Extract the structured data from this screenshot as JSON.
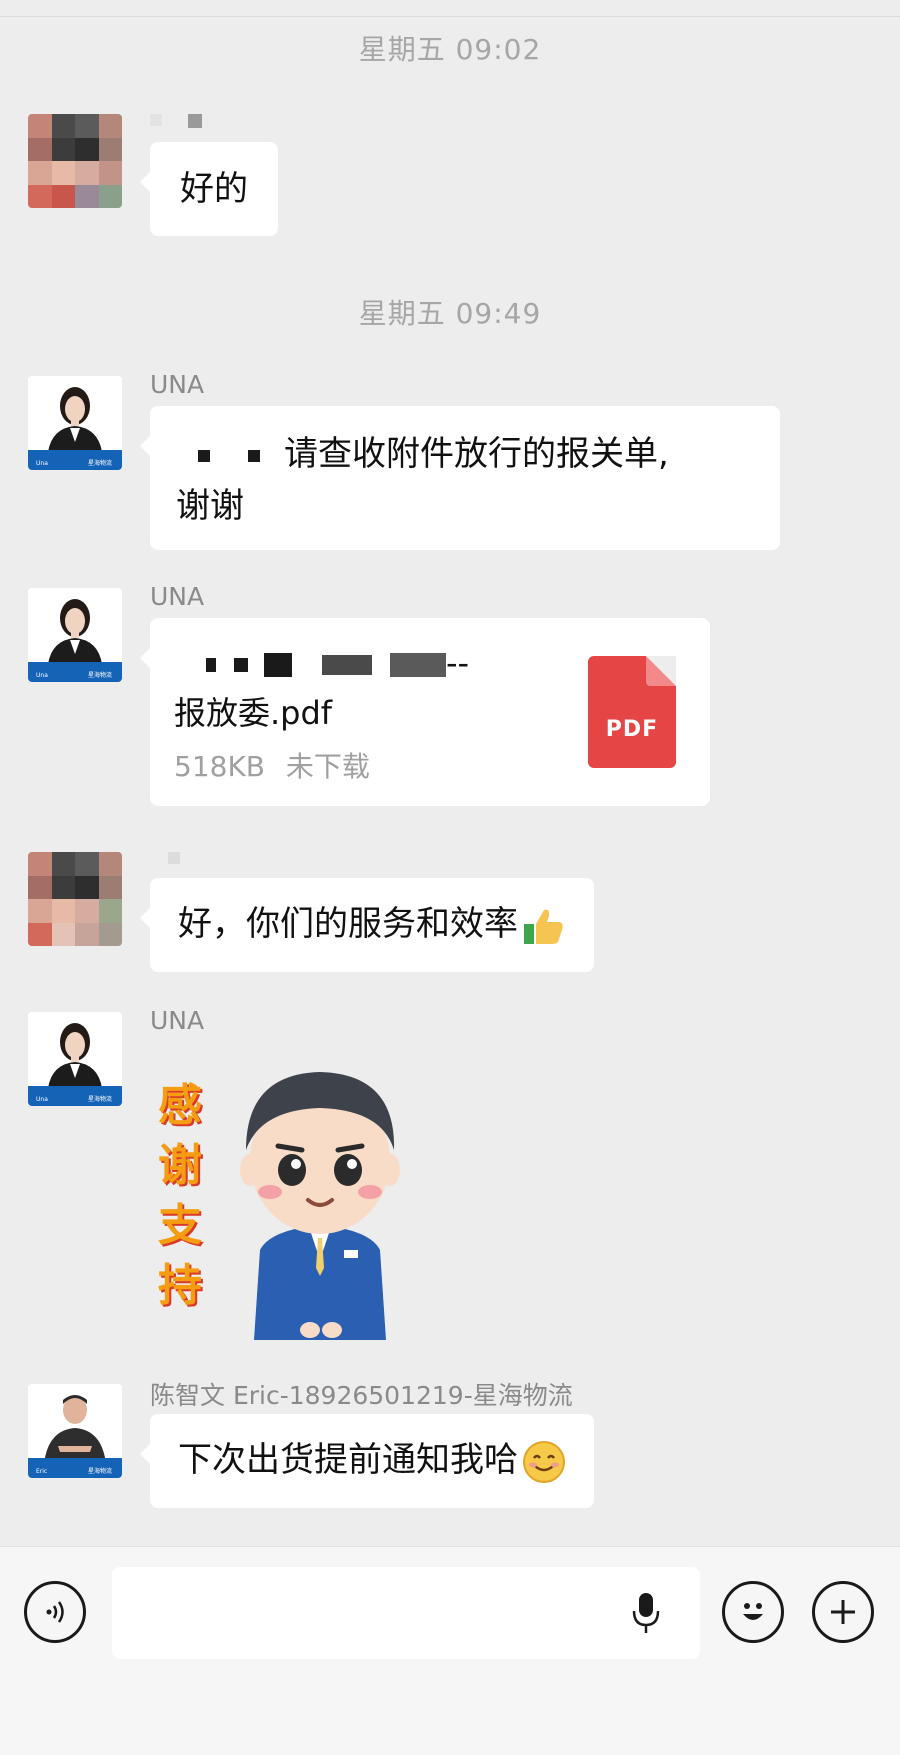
{
  "timestamps": [
    "星期五 09:02",
    "星期五 09:49"
  ],
  "messages": {
    "m1": {
      "text": "好的"
    },
    "m2": {
      "sender": "UNA",
      "text_line1": "请查收附件放行的报关单,",
      "text_line2": "谢谢"
    },
    "m3": {
      "sender": "UNA",
      "file_name_tail": "--",
      "file_name_line2": "报放委.pdf",
      "file_size": "518KB",
      "file_status": "未下载",
      "file_icon_label": "PDF"
    },
    "m4": {
      "text": "好，你们的服务和效率",
      "emoji": "thumbs-up-icon"
    },
    "m5": {
      "sender": "UNA",
      "sticker_text": "感谢支持"
    },
    "m6": {
      "sender": "陈智文 Eric-18926501219-星海物流",
      "text": "下次出货提前通知我哈",
      "emoji": "smile-icon"
    }
  },
  "input_bar": {
    "voice_icon": "voice-icon",
    "mic_icon": "mic-icon",
    "emoji_icon": "emoji-icon",
    "plus_icon": "plus-icon"
  },
  "colors": {
    "background": "#ededed",
    "bubble": "#ffffff",
    "timestamp": "#a6a6a6",
    "pdf_red": "#e64545",
    "brand_blue": "#1563b6"
  }
}
